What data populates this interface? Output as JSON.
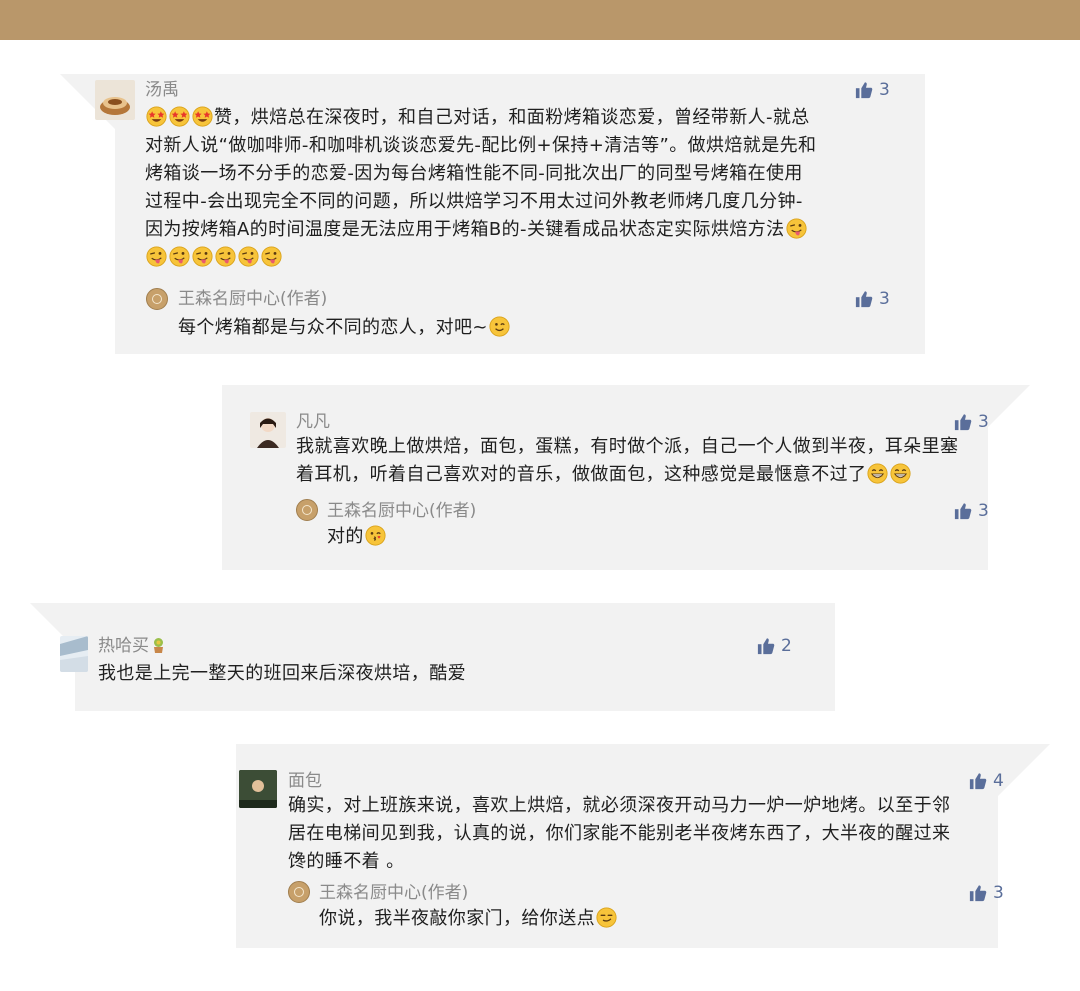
{
  "comments": [
    {
      "user": "汤禹",
      "likes": "3",
      "text_line1": "赞，烘焙总在深夜时，和自己对话，和面粉烤箱谈恋爱，曾经带新人-就总",
      "text_line2": "对新人说“做咖啡师-和咖啡机谈谈恋爱先-配比例+保持+清洁等”。做烘焙就是先和",
      "text_line3": "烤箱谈一场不分手的恋爱-因为每台烤箱性能不同-同批次出厂的同型号烤箱在使用",
      "text_line4": "过程中-会出现完全不同的问题，所以烘焙学习不用太过问外教老师烤几度几分钟-",
      "text_line5": "因为按烤箱A的时间温度是无法应用于烤箱B的-关键看成品状态定实际烘焙方法",
      "reply": {
        "user": "王森名厨中心(作者)",
        "likes": "3",
        "text": "每个烤箱都是与众不同的恋人，对吧~"
      }
    },
    {
      "user": "凡凡",
      "likes": "3",
      "text_line1": "我就喜欢晚上做烘焙，面包，蛋糕，有时做个派，自己一个人做到半夜，耳朵里塞",
      "text_line2": "着耳机，听着自己喜欢对的音乐，做做面包，这种感觉是最惬意不过了",
      "reply": {
        "user": "王森名厨中心(作者)",
        "likes": "3",
        "text": "对的"
      }
    },
    {
      "user": "热哈买",
      "likes": "2",
      "text_line1": "我也是上完一整天的班回来后深夜烘培，酷爱"
    },
    {
      "user": "面包",
      "likes": "4",
      "text_line1": "确实，对上班族来说，喜欢上烘焙，就必须深夜开动马力一炉一炉地烤。以至于邻",
      "text_line2": "居在电梯间见到我，认真的说，你们家能不能别老半夜烤东西了，大半夜的醒过来",
      "text_line3": "馋的睡不着 。",
      "reply": {
        "user": "王森名厨中心(作者)",
        "likes": "3",
        "text": "你说，我半夜敲你家门，给你送点"
      }
    }
  ],
  "colors": {
    "top_bar": "#b9976a",
    "card_bg": "#f2f2f2",
    "like_blue": "#5a6e9a",
    "name_gray": "#8a8a8a"
  },
  "icons": [
    "thumbs-up-icon",
    "star-struck-emoji",
    "tongue-wink-emoji",
    "grin-emoji",
    "smile-emoji",
    "wink-emoji",
    "kiss-wink-emoji",
    "smirk-emoji",
    "author-seal-logo"
  ]
}
